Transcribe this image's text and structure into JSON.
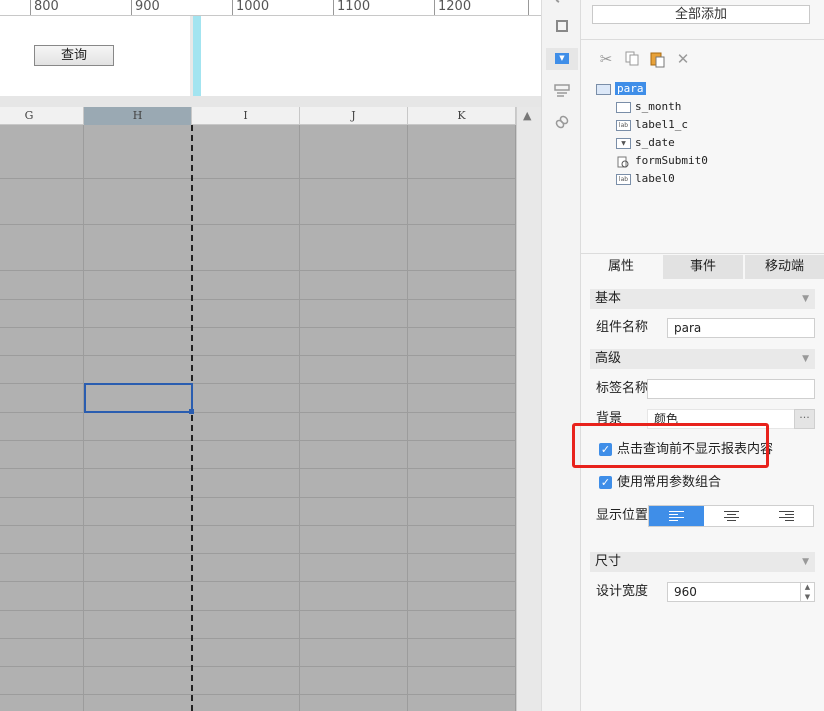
{
  "ruler": {
    "labels": [
      "800",
      "900",
      "1000",
      "1100",
      "1200"
    ]
  },
  "param_pane": {
    "query_button": "查询"
  },
  "sheet": {
    "columns": [
      "G",
      "H",
      "I",
      "J",
      "K"
    ],
    "selected_column": "H"
  },
  "component_panel": {
    "add_all_button": "全部添加",
    "toolbar": [
      "cut-icon",
      "copy-icon",
      "paste-icon",
      "delete-icon"
    ],
    "tree": {
      "root": "para",
      "children": [
        {
          "name": "s_month",
          "type_icon": "month-widget-icon"
        },
        {
          "name": "label1_c",
          "type_icon": "label-icon"
        },
        {
          "name": "s_date",
          "type_icon": "date-widget-icon"
        },
        {
          "name": "formSubmit0",
          "type_icon": "submit-icon"
        },
        {
          "name": "label0",
          "type_icon": "label-icon"
        }
      ],
      "icon_text_lab": "lab"
    }
  },
  "properties": {
    "tabs": [
      "属性",
      "事件",
      "移动端"
    ],
    "active_tab": "属性",
    "basic": {
      "section": "基本",
      "component_name_label": "组件名称",
      "component_name_value": "para"
    },
    "advanced": {
      "section": "高级",
      "tag_name_label": "标签名称",
      "tag_name_value": "",
      "background_label": "背景",
      "background_value": "颜色",
      "color_more": "···",
      "no_display_before_query": {
        "label": "点击查询前不显示报表内容",
        "checked": true
      },
      "use_common_params": {
        "label": "使用常用参数组合",
        "checked": true
      },
      "display_position_label": "显示位置",
      "alignments": [
        "left-align-icon",
        "center-align-icon",
        "right-align-icon"
      ],
      "active_alignment": "left-align-icon"
    },
    "size": {
      "section": "尺寸",
      "design_width_label": "设计宽度",
      "design_width_value": "960"
    }
  },
  "colors": {
    "accent": "#3f8ee8",
    "highlight": "#e8221c",
    "grid": "#b1b1b1",
    "guide": "#a3e4f0"
  }
}
